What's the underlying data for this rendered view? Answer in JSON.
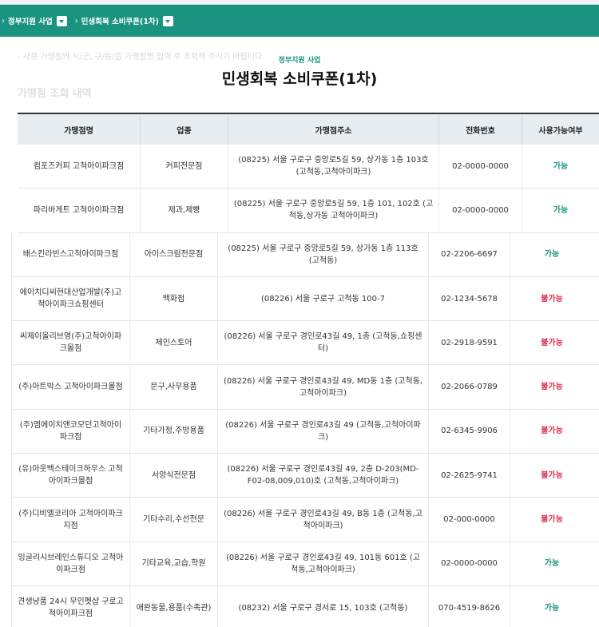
{
  "breadcrumb": {
    "items": [
      "정부지원 사업",
      "민생회복 소비쿠폰(1차)"
    ]
  },
  "header": {
    "ghost_notice": "- 사용 가맹점의 시/군, 구/동/읍 가맹점명 입력 후 조회해 주시기 바랍니다.",
    "ghost_heading": "가맹점 조회 내역",
    "sub_title": "정부지원 사업",
    "main_title": "민생회복 소비쿠폰(1차)"
  },
  "table": {
    "columns": [
      "가맹점명",
      "업종",
      "가맹점주소",
      "전화번호",
      "사용가능여부"
    ],
    "rows": [
      {
        "name": "컴포즈커피 고척아이파크점",
        "category": "커피전문점",
        "address": "(08225) 서울 구로구 중앙로5길 59, 상가동 1층 103호 (고척동,고척아이파크)",
        "phone": "02-0000-0000",
        "status": "가능"
      },
      {
        "name": "파리바게트 고척아이파크점",
        "category": "제과,제빵",
        "address": "(08225) 서울 구로구 중앙로5길 59, 1층 101, 102호 (고척동,상가동 고척아이파크)",
        "phone": "02-0000-0000",
        "status": "가능"
      },
      {
        "name": "배스킨라빈스고척아이파크점",
        "category": "아이스크림전문점",
        "address": "(08225) 서울 구로구 중앙로5길 59, 상가동 1층 113호 (고척동)",
        "phone": "02-2206-6697",
        "status": "가능"
      },
      {
        "name": "에이치디씨현대산업개발(주)고척아이파크쇼핑센터",
        "category": "백화점",
        "address": "(08226) 서울 구로구 고척동 100-7",
        "phone": "02-1234-5678",
        "status": "불가능"
      },
      {
        "name": "씨제이올리브영(주)고척아이파크몰점",
        "category": "체인스토어",
        "address": "(08226) 서울 구로구 경인로43길 49, 1층 (고척동,쇼핑센터)",
        "phone": "02-2918-9591",
        "status": "불가능"
      },
      {
        "name": "(주)아트박스 고척아이파크몰점",
        "category": "문구,사무용품",
        "address": "(08226) 서울 구로구 경인로43길 49, MD동 1층 (고척동,고척아이파크)",
        "phone": "02-2066-0789",
        "status": "불가능"
      },
      {
        "name": "(주)엠에이치앤코모던고척아이파크점",
        "category": "기타가정,주방용품",
        "address": "(08226) 서울 구로구 경인로43길 49 (고척동,고척아이파크)",
        "phone": "02-6345-9906",
        "status": "불가능"
      },
      {
        "name": "(유)아웃백스테이크하우스 고척아이파크몰점",
        "category": "서양식전문점",
        "address": "(08226) 서울 구로구 경인로43길 49, 2층 D-203(MD-F02-08,009,010)호 (고척동,고척아이파크)",
        "phone": "02-2625-9741",
        "status": "불가능"
      },
      {
        "name": "(주)디비엘코리아 고척아이파크지점",
        "category": "기타수리,수선전문",
        "address": "(08226) 서울 구로구 경인로43길 49, B동 1층 (고척동,고척아이파크)",
        "phone": "02-000-0000",
        "status": "불가능"
      },
      {
        "name": "잉글리시브레인스튜디오 고척아이파크점",
        "category": "기타교육,교습,학원",
        "address": "(08226) 서울 구로구 경인로43길 49, 101동 601호 (고척동,고척아이파크)",
        "phone": "02-0000-0000",
        "status": "가능"
      },
      {
        "name": "견생냥품 24시 무인펫샵 구로고척아이파크점",
        "category": "애완동물,용품(수족관)",
        "address": "(08232) 서울 구로구 경서로 15, 103호 (고척동)",
        "phone": "070-4519-8626",
        "status": "가능"
      }
    ]
  },
  "colors": {
    "nav_bg": "#1a9480",
    "available": "#1a9480",
    "unavailable": "#e0334f"
  }
}
